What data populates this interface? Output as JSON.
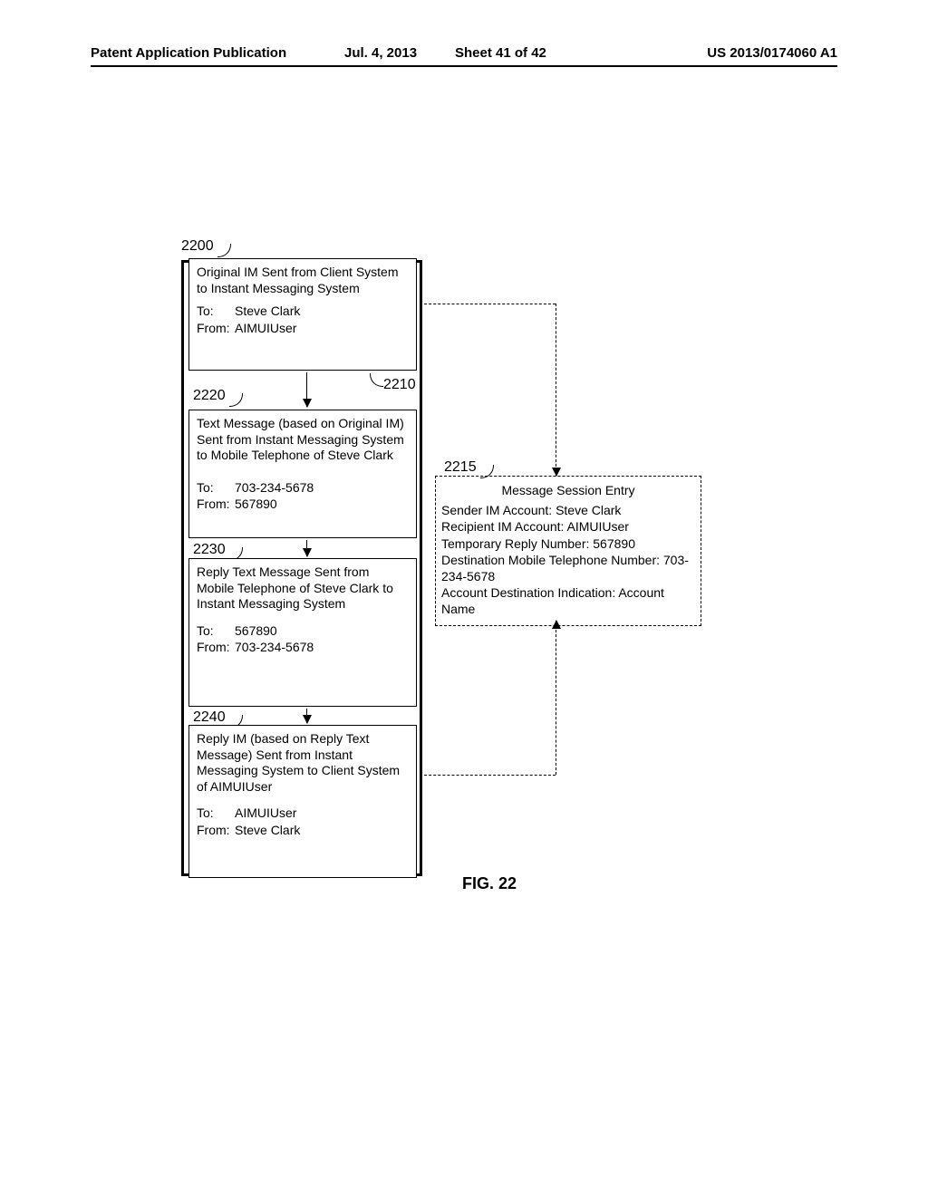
{
  "header": {
    "publication": "Patent Application Publication",
    "date": "Jul. 4, 2013",
    "sheet": "Sheet 41 of 42",
    "pubno": "US 2013/0174060 A1"
  },
  "refs": {
    "r2200": "2200",
    "r2210": "2210",
    "r2215": "2215",
    "r2220": "2220",
    "r2230": "2230",
    "r2240": "2240"
  },
  "box2210": {
    "title": "Original IM Sent from Client System to Instant Messaging System",
    "to_label": "To:",
    "to_value": "Steve Clark",
    "from_label": "From:",
    "from_value": "AIMUIUser"
  },
  "box2220": {
    "title": "Text Message (based on Original IM) Sent from Instant Messaging System to Mobile Telephone of Steve Clark",
    "to_label": "To:",
    "to_value": "703-234-5678",
    "from_label": "From:",
    "from_value": "567890"
  },
  "box2230": {
    "title": "Reply Text Message Sent from Mobile Telephone of Steve Clark to Instant Messaging System",
    "to_label": "To:",
    "to_value": "567890",
    "from_label": "From:",
    "from_value": "703-234-5678"
  },
  "box2240": {
    "title": "Reply IM (based on Reply Text Message) Sent from Instant Messaging System to Client System of AIMUIUser",
    "to_label": "To:",
    "to_value": "AIMUIUser",
    "from_label": "From:",
    "from_value": "Steve Clark"
  },
  "session": {
    "title": "Message Session Entry",
    "line1": "Sender IM Account:  Steve Clark",
    "line2": "Recipient IM Account:  AIMUIUser",
    "line3": "Temporary Reply Number:  567890",
    "line4": "Destination Mobile Telephone Number: 703-234-5678",
    "line5": "Account Destination Indication:  Account Name"
  },
  "caption": "FIG. 22"
}
